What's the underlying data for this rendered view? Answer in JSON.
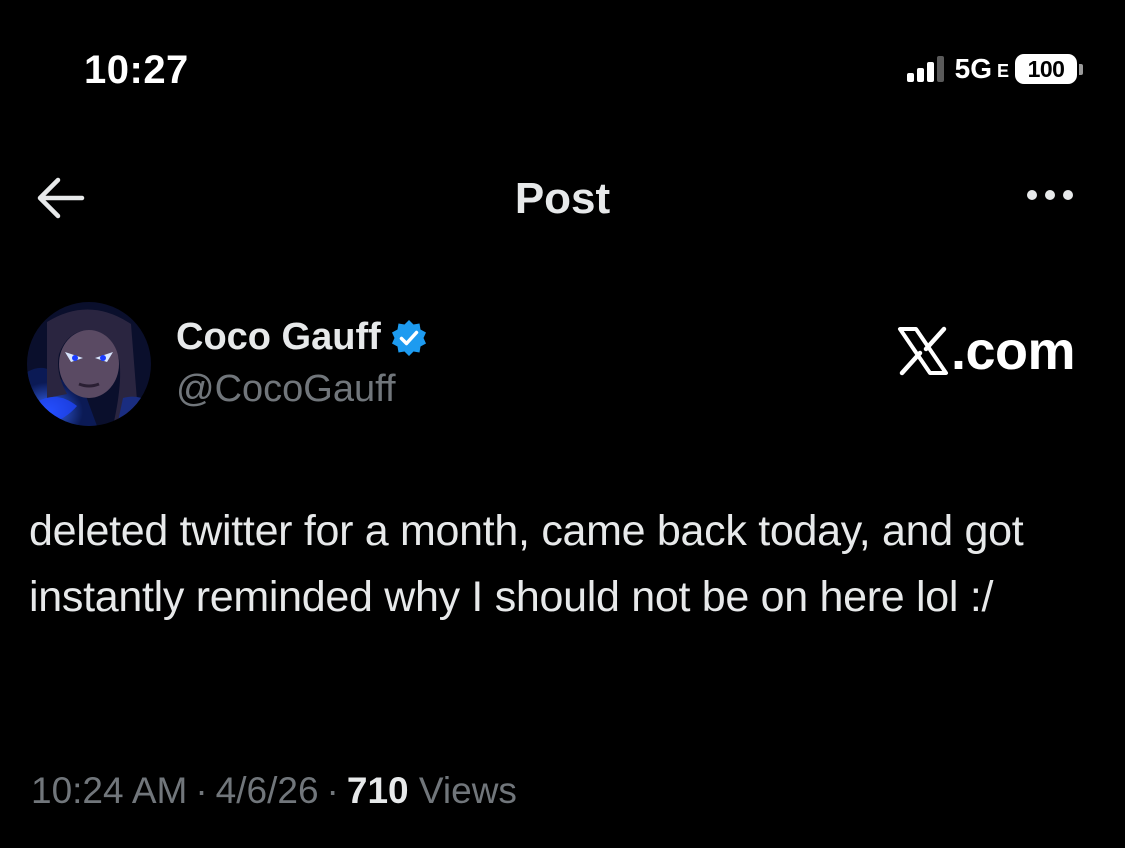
{
  "status_bar": {
    "time": "10:27",
    "network": "5G",
    "network_sub": "E",
    "battery_level": "100",
    "signal_bars_active": 3,
    "signal_bars_total": 4
  },
  "header": {
    "title": "Post",
    "back_icon": "arrow-left-icon",
    "more_icon": "ellipsis-icon"
  },
  "post": {
    "author": {
      "name": "Coco Gauff",
      "handle": "@CocoGauff",
      "verified": true,
      "badge_color": "#1d9bf0"
    },
    "watermark": {
      "text": ".com",
      "icon": "x-logo-icon"
    },
    "text": "deleted twitter for a month, came back today, and got instantly reminded why I should not be on here lol :/",
    "meta": {
      "time": "10:24 AM",
      "date": "4/6/26",
      "separator": "·",
      "views_count": "710",
      "views_label": "Views"
    }
  },
  "colors": {
    "background": "#000000",
    "primary_text": "#e7e9ea",
    "secondary_text": "#71767b",
    "verified_blue": "#1d9bf0"
  }
}
